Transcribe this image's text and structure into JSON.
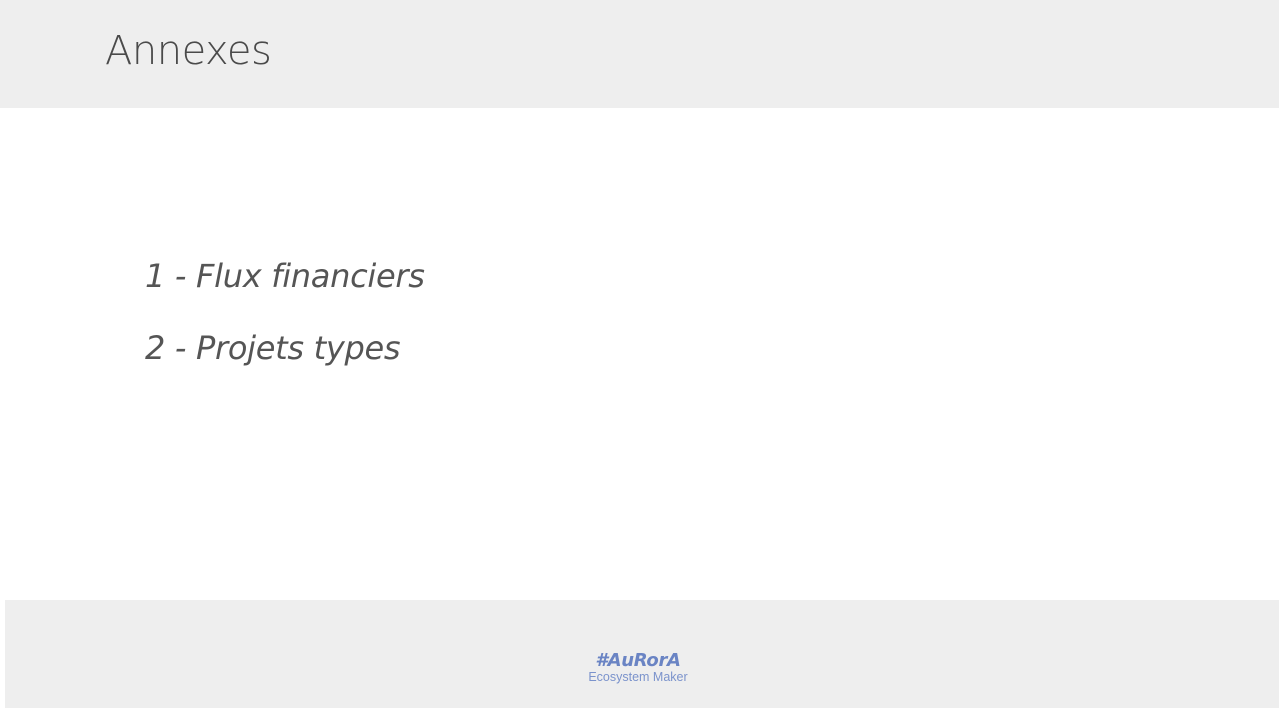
{
  "slide": {
    "title": "Annexes",
    "items": [
      {
        "label": "1 - Flux financiers"
      },
      {
        "label": "2 - Projets types"
      }
    ]
  },
  "footer": {
    "logo_hashtag": "#AuRorA",
    "logo_tagline": "Ecosystem Maker"
  },
  "colors": {
    "band_background": "#eeeeee",
    "title_text": "#4a4a4a",
    "body_text": "#555555",
    "logo_accent": "#6a84c4"
  }
}
